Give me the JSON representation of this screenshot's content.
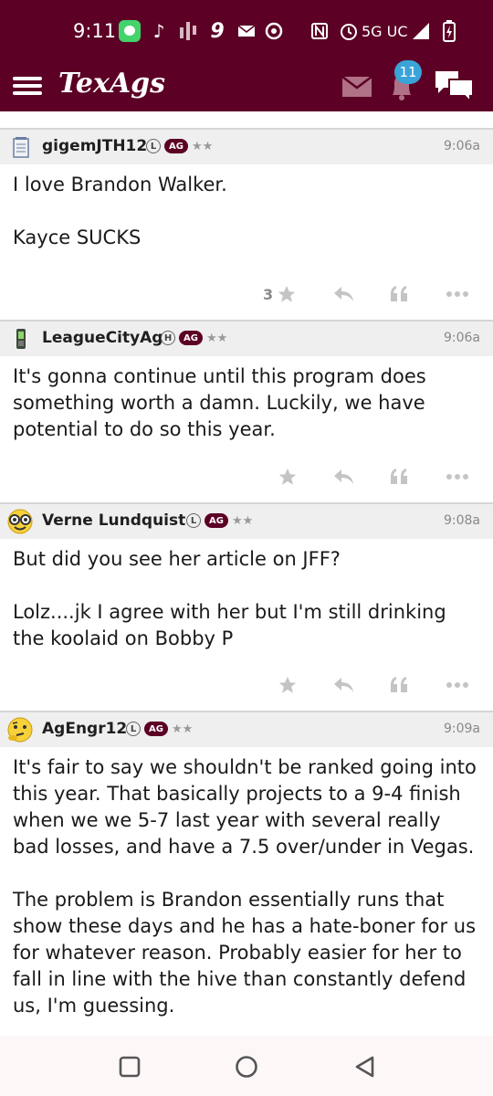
{
  "status_bar": {
    "time": "9:11",
    "network": "5G UC",
    "icons": [
      "messages-icon",
      "tiktok-icon",
      "bars-app-icon",
      "nine-app-icon",
      "mail-icon",
      "chrome-icon",
      "nfc-icon",
      "alarm-icon",
      "signal-icon",
      "battery-icon"
    ]
  },
  "header": {
    "logo": "TexAgs",
    "notification_count": "11",
    "icons": [
      "menu-icon",
      "mail-icon",
      "bell-icon",
      "chat-icon"
    ],
    "bg_color": "#5c0025"
  },
  "badges": {
    "ag": "AG",
    "stars": "★★"
  },
  "posts": [
    {
      "username": "gigemJTH12",
      "badge": "L",
      "time": "9:06a",
      "avatar": "notepad-icon",
      "body": [
        "I love Brandon Walker.",
        "Kayce SUCKS"
      ],
      "star_count": "3"
    },
    {
      "username": "LeagueCityAg",
      "badge": "H",
      "time": "9:06a",
      "avatar": "phone-icon",
      "body": [
        "It's gonna continue until this program does something worth a damn. Luckily, we have potential to do so this year."
      ],
      "star_count": ""
    },
    {
      "username": "Verne Lundquist",
      "badge": "L",
      "time": "9:08a",
      "avatar": "nerd-face-icon",
      "body": [
        "But did you see her article on JFF?",
        "Lolz....jk I agree with her but I'm still drinking the koolaid on Bobby P"
      ],
      "star_count": ""
    },
    {
      "username": "AgEngr12",
      "badge": "L",
      "time": "9:09a",
      "avatar": "thinking-face-icon",
      "body": [
        "It's fair to say we shouldn't be ranked going into this year. That basically projects to a 9-4 finish when we we 5-7 last year with several really bad losses, and have a 7.5 over/under in Vegas.",
        "The problem is Brandon essentially runs that show these days and he has a hate-boner for us for whatever reason. Probably easier for her to fall in line with the hive than constantly defend us, I'm guessing."
      ],
      "star_count": ""
    }
  ],
  "nav": {
    "icons": [
      "recents-icon",
      "home-icon",
      "back-icon"
    ]
  }
}
